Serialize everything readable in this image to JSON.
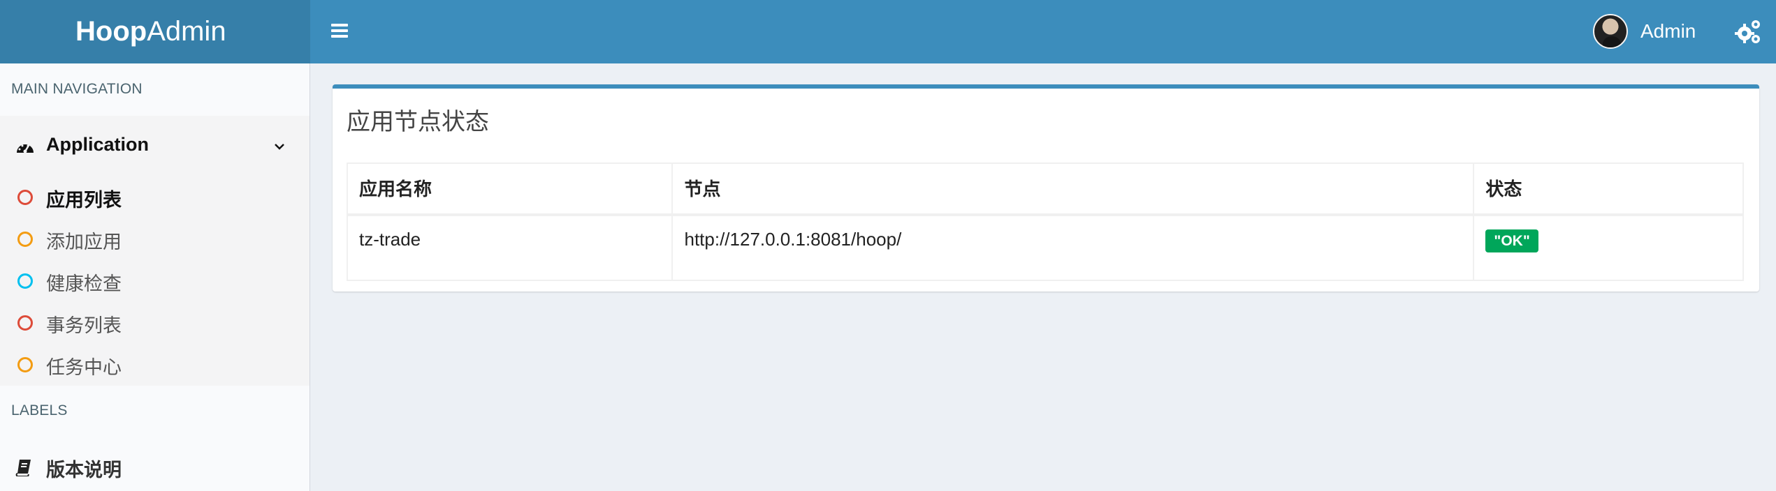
{
  "header": {
    "logo_bold": "Hoop",
    "logo_light": "Admin",
    "user_name": "Admin",
    "icons": [
      "menu-icon",
      "avatar",
      "gears-icon"
    ],
    "background_color": "#3c8dbc"
  },
  "sidebar": {
    "main_navigation_title": "MAIN NAVIGATION",
    "application": {
      "label": "Application",
      "icon": "dashboard-icon",
      "expanded": true
    },
    "items": [
      {
        "label": "应用列表",
        "active": true,
        "circle_color": "#dd4b39"
      },
      {
        "label": "添加应用",
        "active": false,
        "circle_color": "#f39c12"
      },
      {
        "label": "健康检查",
        "active": false,
        "circle_color": "#00c0ef"
      },
      {
        "label": "事务列表",
        "active": false,
        "circle_color": "#dd4b39"
      },
      {
        "label": "任务中心",
        "active": false,
        "circle_color": "#f39c12"
      }
    ],
    "labels_title": "LABELS",
    "version": {
      "label": "版本说明",
      "icon": "book-icon"
    }
  },
  "main": {
    "box_title": "应用节点状态",
    "table": {
      "headers": [
        "应用名称",
        "节点",
        "状态"
      ],
      "rows": [
        {
          "app_name": "tz-trade",
          "node": "http://127.0.0.1:8081/hoop/",
          "status": "\"OK\""
        }
      ]
    },
    "status_color": "#00a65a"
  }
}
